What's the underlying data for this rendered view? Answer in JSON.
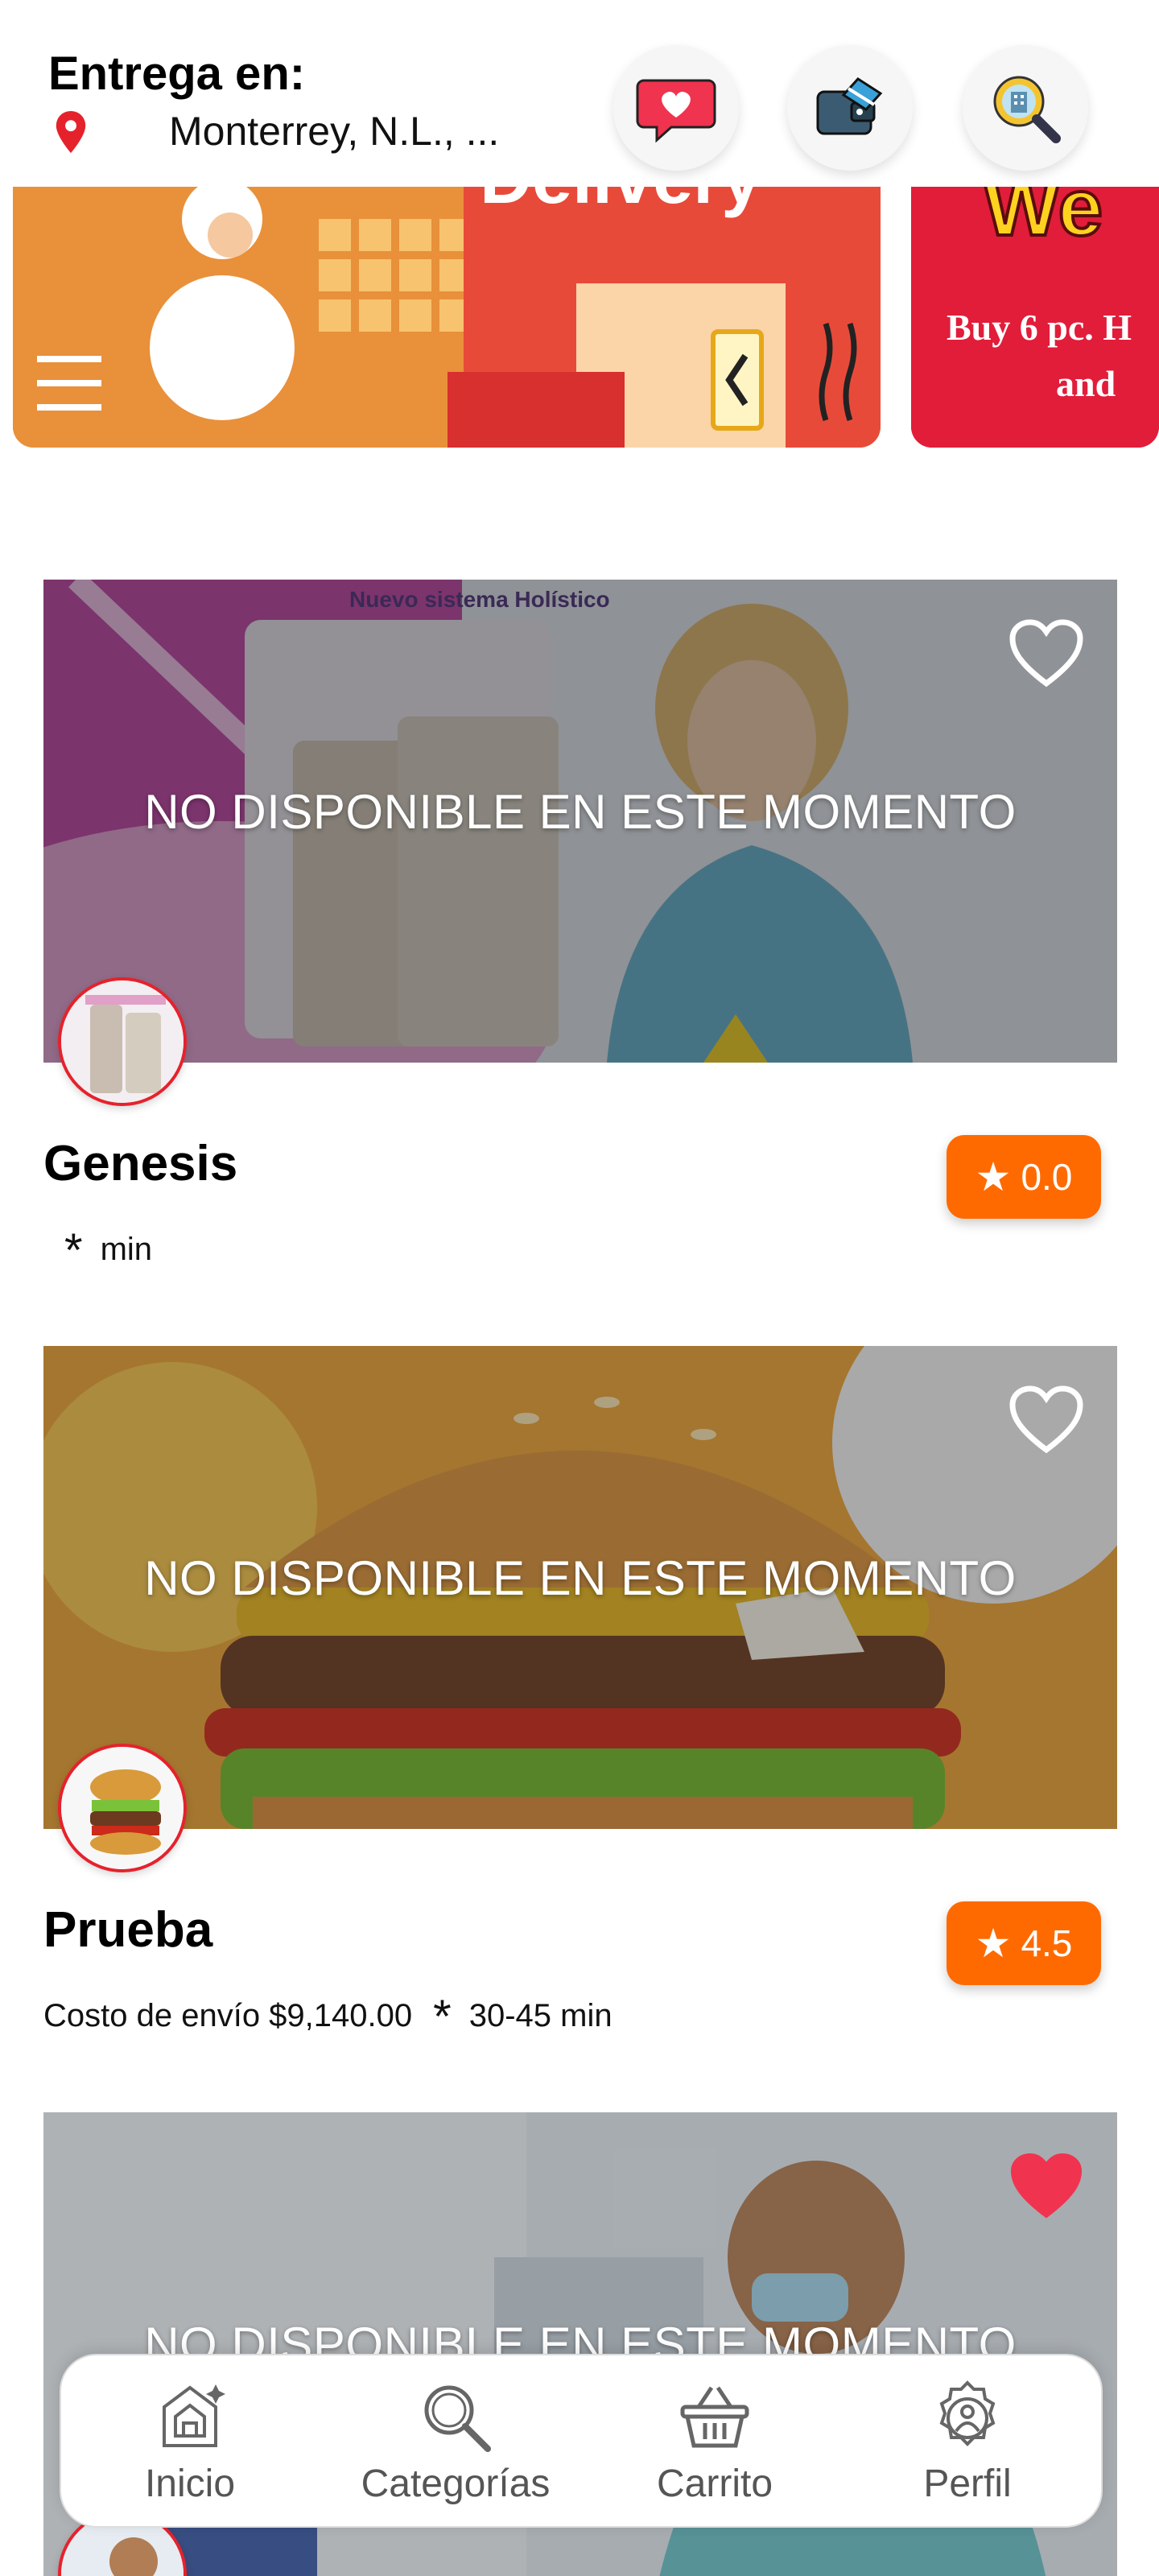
{
  "header": {
    "title": "Entrega en:",
    "location": "Monterrey, N.L., ...",
    "buttons": [
      {
        "icon": "favorites-message-icon"
      },
      {
        "icon": "wallet-icon"
      },
      {
        "icon": "store-search-icon"
      }
    ]
  },
  "banners": [
    {
      "name": "delivery-banner",
      "visible_text": "Delivery"
    },
    {
      "name": "promo-banner",
      "visible_text": "We",
      "line1": "Buy 6 pc. H",
      "line2": "and"
    }
  ],
  "stores": [
    {
      "name": "Genesis",
      "status": "NO DISPONIBLE EN ESTE MOMENTO",
      "shipping": "",
      "time": "min",
      "rating": "0.0",
      "favorite": false
    },
    {
      "name": "Prueba",
      "status": "NO DISPONIBLE EN ESTE MOMENTO",
      "shipping": "Costo de envío $9,140.00",
      "time": "30-45 min",
      "rating": "4.5",
      "favorite": false
    },
    {
      "name": "",
      "status": "NO DISPONIBLE EN ESTE MOMENTO",
      "favorite": true
    }
  ],
  "nav": {
    "items": [
      {
        "label": "Inicio",
        "icon": "home-icon"
      },
      {
        "label": "Categorías",
        "icon": "search-icon"
      },
      {
        "label": "Carrito",
        "icon": "basket-icon"
      },
      {
        "label": "Perfil",
        "icon": "profile-gear-icon"
      }
    ]
  },
  "colors": {
    "accent": "#ff6a00",
    "favorite": "#f0334f",
    "pin": "#e5222c"
  }
}
